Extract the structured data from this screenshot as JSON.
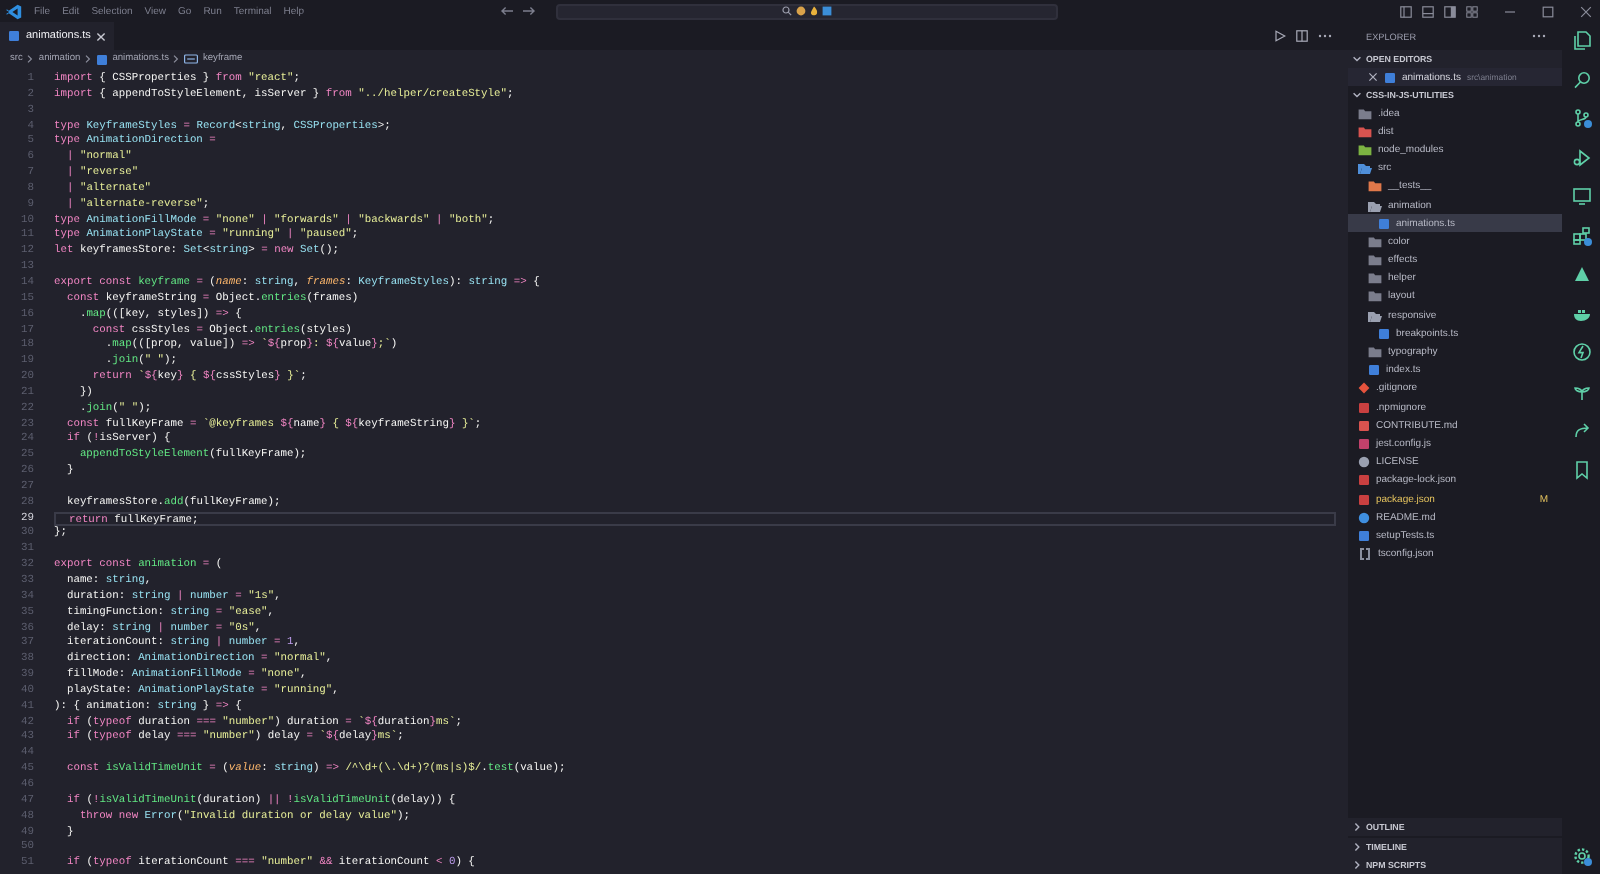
{
  "title_bar": {
    "menu": [
      "File",
      "Edit",
      "Selection",
      "View",
      "Go",
      "Run",
      "Terminal",
      "Help"
    ]
  },
  "tabs": [
    {
      "label": "animations.ts",
      "selected": true
    }
  ],
  "breadcrumb": [
    {
      "label": "src",
      "kind": "folder"
    },
    {
      "label": "animation",
      "kind": "folder"
    },
    {
      "label": "animations.ts",
      "kind": "ts"
    },
    {
      "label": "keyframe",
      "kind": "symbol"
    }
  ],
  "editor": {
    "lines": [
      {
        "number": "1",
        "current": false,
        "tokens": [
          {
            "kind": "kw",
            "text": "import"
          },
          {
            "kind": "text",
            "text": " { CSSProperties } "
          },
          {
            "kind": "kw",
            "text": "from"
          },
          {
            "kind": "str",
            "text": " \"react\""
          },
          {
            "kind": "text",
            "text": ";"
          }
        ]
      },
      {
        "number": "2",
        "current": false,
        "tokens": [
          {
            "kind": "kw",
            "text": "import"
          },
          {
            "kind": "text",
            "text": " { appendToStyleElement, isServer } "
          },
          {
            "kind": "kw",
            "text": "from"
          },
          {
            "kind": "str",
            "text": " \"../helper/createStyle\""
          },
          {
            "kind": "text",
            "text": ";"
          }
        ]
      },
      {
        "number": "3",
        "current": false
      },
      {
        "number": "4",
        "current": false,
        "tokens": [
          {
            "kind": "kw",
            "text": "type"
          },
          {
            "kind": "type",
            "text": " KeyframeStyles"
          },
          {
            "kind": "op",
            "text": " = "
          },
          {
            "kind": "type",
            "text": "Record"
          },
          {
            "kind": "text",
            "text": "<"
          },
          {
            "kind": "type",
            "text": "string"
          },
          {
            "kind": "text",
            "text": ", "
          },
          {
            "kind": "type",
            "text": "CSSProperties"
          },
          {
            "kind": "text",
            "text": ">;"
          }
        ]
      },
      {
        "number": "5",
        "current": false,
        "tokens": [
          {
            "kind": "kw",
            "text": "type"
          },
          {
            "kind": "type",
            "text": " AnimationDirection"
          },
          {
            "kind": "op",
            "text": " ="
          }
        ]
      },
      {
        "number": "6",
        "current": false,
        "tokens": [
          {
            "kind": "op",
            "text": "  | "
          },
          {
            "kind": "str",
            "text": "\"normal\""
          }
        ]
      },
      {
        "number": "7",
        "current": false,
        "tokens": [
          {
            "kind": "op",
            "text": "  | "
          },
          {
            "kind": "str",
            "text": "\"reverse\""
          }
        ]
      },
      {
        "number": "8",
        "current": false,
        "tokens": [
          {
            "kind": "op",
            "text": "  | "
          },
          {
            "kind": "str",
            "text": "\"alternate\""
          }
        ]
      },
      {
        "number": "9",
        "current": false,
        "tokens": [
          {
            "kind": "op",
            "text": "  | "
          },
          {
            "kind": "str",
            "text": "\"alternate-reverse\""
          },
          {
            "kind": "text",
            "text": ";"
          }
        ]
      },
      {
        "number": "10",
        "current": false,
        "tokens": [
          {
            "kind": "kw",
            "text": "type"
          },
          {
            "kind": "type",
            "text": " AnimationFillMode"
          },
          {
            "kind": "op",
            "text": " = "
          },
          {
            "kind": "str",
            "text": "\"none\""
          },
          {
            "kind": "op",
            "text": " | "
          },
          {
            "kind": "str",
            "text": "\"forwards\""
          },
          {
            "kind": "op",
            "text": " | "
          },
          {
            "kind": "str",
            "text": "\"backwards\""
          },
          {
            "kind": "op",
            "text": " | "
          },
          {
            "kind": "str",
            "text": "\"both\""
          },
          {
            "kind": "text",
            "text": ";"
          }
        ]
      },
      {
        "number": "11",
        "current": false,
        "tokens": [
          {
            "kind": "kw",
            "text": "type"
          },
          {
            "kind": "type",
            "text": " AnimationPlayState"
          },
          {
            "kind": "op",
            "text": " = "
          },
          {
            "kind": "str",
            "text": "\"running\""
          },
          {
            "kind": "op",
            "text": " | "
          },
          {
            "kind": "str",
            "text": "\"paused\""
          },
          {
            "kind": "text",
            "text": ";"
          }
        ]
      },
      {
        "number": "12",
        "current": false,
        "tokens": [
          {
            "kind": "kw",
            "text": "let"
          },
          {
            "kind": "text",
            "text": " keyframesStore: "
          },
          {
            "kind": "type",
            "text": "Set"
          },
          {
            "kind": "text",
            "text": "<"
          },
          {
            "kind": "type",
            "text": "string"
          },
          {
            "kind": "text",
            "text": "> "
          },
          {
            "kind": "op",
            "text": "="
          },
          {
            "kind": "kw",
            "text": " new"
          },
          {
            "kind": "type",
            "text": " Set"
          },
          {
            "kind": "text",
            "text": "();"
          }
        ]
      },
      {
        "number": "13",
        "current": false
      },
      {
        "number": "14",
        "current": false,
        "tokens": [
          {
            "kind": "kw",
            "text": "export const"
          },
          {
            "kind": "fn",
            "text": " keyframe"
          },
          {
            "kind": "op",
            "text": " = "
          },
          {
            "kind": "text",
            "text": "("
          },
          {
            "kind": "param",
            "text": "name"
          },
          {
            "kind": "text",
            "text": ": "
          },
          {
            "kind": "type",
            "text": "string"
          },
          {
            "kind": "text",
            "text": ", "
          },
          {
            "kind": "param",
            "text": "frames"
          },
          {
            "kind": "text",
            "text": ": "
          },
          {
            "kind": "type",
            "text": "KeyframeStyles"
          },
          {
            "kind": "text",
            "text": "): "
          },
          {
            "kind": "type",
            "text": "string"
          },
          {
            "kind": "op",
            "text": " =>"
          },
          {
            "kind": "text",
            "text": " {"
          }
        ]
      },
      {
        "number": "15",
        "current": false,
        "tokens": [
          {
            "kind": "kw",
            "text": "  const"
          },
          {
            "kind": "text",
            "text": " keyframeString "
          },
          {
            "kind": "op",
            "text": "="
          },
          {
            "kind": "text",
            "text": " Object."
          },
          {
            "kind": "fn",
            "text": "entries"
          },
          {
            "kind": "text",
            "text": "(frames)"
          }
        ]
      },
      {
        "number": "16",
        "current": false,
        "tokens": [
          {
            "kind": "text",
            "text": "    ."
          },
          {
            "kind": "fn",
            "text": "map"
          },
          {
            "kind": "text",
            "text": "(([key, styles]) "
          },
          {
            "kind": "op",
            "text": "=>"
          },
          {
            "kind": "text",
            "text": " {"
          }
        ]
      },
      {
        "number": "17",
        "current": false,
        "tokens": [
          {
            "kind": "kw",
            "text": "      const"
          },
          {
            "kind": "text",
            "text": " cssStyles "
          },
          {
            "kind": "op",
            "text": "="
          },
          {
            "kind": "text",
            "text": " Object."
          },
          {
            "kind": "fn",
            "text": "entries"
          },
          {
            "kind": "text",
            "text": "(styles)"
          }
        ]
      },
      {
        "number": "18",
        "current": false,
        "tokens": [
          {
            "kind": "text",
            "text": "        ."
          },
          {
            "kind": "fn",
            "text": "map"
          },
          {
            "kind": "text",
            "text": "(([prop, value]) "
          },
          {
            "kind": "op",
            "text": "=>"
          },
          {
            "kind": "str",
            "text": " `"
          },
          {
            "kind": "kw",
            "text": "${"
          },
          {
            "kind": "text",
            "text": "prop"
          },
          {
            "kind": "kw",
            "text": "}"
          },
          {
            "kind": "str",
            "text": ": "
          },
          {
            "kind": "kw",
            "text": "${"
          },
          {
            "kind": "text",
            "text": "value"
          },
          {
            "kind": "kw",
            "text": "}"
          },
          {
            "kind": "str",
            "text": ";`"
          },
          {
            "kind": "text",
            "text": ")"
          }
        ]
      },
      {
        "number": "19",
        "current": false,
        "tokens": [
          {
            "kind": "text",
            "text": "        ."
          },
          {
            "kind": "fn",
            "text": "join"
          },
          {
            "kind": "text",
            "text": "("
          },
          {
            "kind": "str",
            "text": "\" \""
          },
          {
            "kind": "text",
            "text": ");"
          }
        ]
      },
      {
        "number": "20",
        "current": false,
        "tokens": [
          {
            "kind": "kw",
            "text": "      return"
          },
          {
            "kind": "str",
            "text": " `"
          },
          {
            "kind": "kw",
            "text": "${"
          },
          {
            "kind": "text",
            "text": "key"
          },
          {
            "kind": "kw",
            "text": "}"
          },
          {
            "kind": "str",
            "text": " { "
          },
          {
            "kind": "kw",
            "text": "${"
          },
          {
            "kind": "text",
            "text": "cssStyles"
          },
          {
            "kind": "kw",
            "text": "}"
          },
          {
            "kind": "str",
            "text": " }`"
          },
          {
            "kind": "text",
            "text": ";"
          }
        ]
      },
      {
        "number": "21",
        "current": false,
        "tokens": [
          {
            "kind": "text",
            "text": "    })"
          }
        ]
      },
      {
        "number": "22",
        "current": false,
        "tokens": [
          {
            "kind": "text",
            "text": "    ."
          },
          {
            "kind": "fn",
            "text": "join"
          },
          {
            "kind": "text",
            "text": "("
          },
          {
            "kind": "str",
            "text": "\" \""
          },
          {
            "kind": "text",
            "text": ");"
          }
        ]
      },
      {
        "number": "23",
        "current": false,
        "tokens": [
          {
            "kind": "kw",
            "text": "  const"
          },
          {
            "kind": "text",
            "text": " fullKeyFrame "
          },
          {
            "kind": "op",
            "text": "="
          },
          {
            "kind": "str",
            "text": " `@keyframes "
          },
          {
            "kind": "kw",
            "text": "${"
          },
          {
            "kind": "text",
            "text": "name"
          },
          {
            "kind": "kw",
            "text": "}"
          },
          {
            "kind": "str",
            "text": " { "
          },
          {
            "kind": "kw",
            "text": "${"
          },
          {
            "kind": "text",
            "text": "keyframeString"
          },
          {
            "kind": "kw",
            "text": "}"
          },
          {
            "kind": "str",
            "text": " }`"
          },
          {
            "kind": "text",
            "text": ";"
          }
        ]
      },
      {
        "number": "24",
        "current": false,
        "tokens": [
          {
            "kind": "kw",
            "text": "  if"
          },
          {
            "kind": "text",
            "text": " ("
          },
          {
            "kind": "op",
            "text": "!"
          },
          {
            "kind": "text",
            "text": "isServer) {"
          }
        ]
      },
      {
        "number": "25",
        "current": false,
        "tokens": [
          {
            "kind": "fn",
            "text": "    appendToStyleElement"
          },
          {
            "kind": "text",
            "text": "(fullKeyFrame);"
          }
        ]
      },
      {
        "number": "26",
        "current": false,
        "tokens": [
          {
            "kind": "text",
            "text": "  }"
          }
        ]
      },
      {
        "number": "27",
        "current": false
      },
      {
        "number": "28",
        "current": false,
        "tokens": [
          {
            "kind": "text",
            "text": "  keyframesStore."
          },
          {
            "kind": "fn",
            "text": "add"
          },
          {
            "kind": "text",
            "text": "(fullKeyFrame);"
          }
        ]
      },
      {
        "number": "29",
        "current": true,
        "tokens": [
          {
            "kind": "kw",
            "text": "  return"
          },
          {
            "kind": "text",
            "text": " fullKeyFrame;"
          }
        ]
      },
      {
        "number": "30",
        "current": false,
        "tokens": [
          {
            "kind": "text",
            "text": "};"
          }
        ]
      },
      {
        "number": "31",
        "current": false
      },
      {
        "number": "32",
        "current": false,
        "tokens": [
          {
            "kind": "kw",
            "text": "export const"
          },
          {
            "kind": "fn",
            "text": " animation"
          },
          {
            "kind": "op",
            "text": " = "
          },
          {
            "kind": "text",
            "text": "("
          }
        ]
      },
      {
        "number": "33",
        "current": false,
        "tokens": [
          {
            "kind": "text",
            "text": "  name: "
          },
          {
            "kind": "type",
            "text": "string"
          },
          {
            "kind": "text",
            "text": ","
          }
        ]
      },
      {
        "number": "34",
        "current": false,
        "tokens": [
          {
            "kind": "text",
            "text": "  duration: "
          },
          {
            "kind": "type",
            "text": "string"
          },
          {
            "kind": "op",
            "text": " | "
          },
          {
            "kind": "type",
            "text": "number"
          },
          {
            "kind": "op",
            "text": " = "
          },
          {
            "kind": "str",
            "text": "\"1s\""
          },
          {
            "kind": "text",
            "text": ","
          }
        ]
      },
      {
        "number": "35",
        "current": false,
        "tokens": [
          {
            "kind": "text",
            "text": "  timingFunction: "
          },
          {
            "kind": "type",
            "text": "string"
          },
          {
            "kind": "op",
            "text": " = "
          },
          {
            "kind": "str",
            "text": "\"ease\""
          },
          {
            "kind": "text",
            "text": ","
          }
        ]
      },
      {
        "number": "36",
        "current": false,
        "tokens": [
          {
            "kind": "text",
            "text": "  delay: "
          },
          {
            "kind": "type",
            "text": "string"
          },
          {
            "kind": "op",
            "text": " | "
          },
          {
            "kind": "type",
            "text": "number"
          },
          {
            "kind": "op",
            "text": " = "
          },
          {
            "kind": "str",
            "text": "\"0s\""
          },
          {
            "kind": "text",
            "text": ","
          }
        ]
      },
      {
        "number": "37",
        "current": false,
        "tokens": [
          {
            "kind": "text",
            "text": "  iterationCount: "
          },
          {
            "kind": "type",
            "text": "string"
          },
          {
            "kind": "op",
            "text": " | "
          },
          {
            "kind": "type",
            "text": "number"
          },
          {
            "kind": "op",
            "text": " = "
          },
          {
            "kind": "num",
            "text": "1"
          },
          {
            "kind": "text",
            "text": ","
          }
        ]
      },
      {
        "number": "38",
        "current": false,
        "tokens": [
          {
            "kind": "text",
            "text": "  direction: "
          },
          {
            "kind": "type",
            "text": "AnimationDirection"
          },
          {
            "kind": "op",
            "text": " = "
          },
          {
            "kind": "str",
            "text": "\"normal\""
          },
          {
            "kind": "text",
            "text": ","
          }
        ]
      },
      {
        "number": "39",
        "current": false,
        "tokens": [
          {
            "kind": "text",
            "text": "  fillMode: "
          },
          {
            "kind": "type",
            "text": "AnimationFillMode"
          },
          {
            "kind": "op",
            "text": " = "
          },
          {
            "kind": "str",
            "text": "\"none\""
          },
          {
            "kind": "text",
            "text": ","
          }
        ]
      },
      {
        "number": "40",
        "current": false,
        "tokens": [
          {
            "kind": "text",
            "text": "  playState: "
          },
          {
            "kind": "type",
            "text": "AnimationPlayState"
          },
          {
            "kind": "op",
            "text": " = "
          },
          {
            "kind": "str",
            "text": "\"running\""
          },
          {
            "kind": "text",
            "text": ","
          }
        ]
      },
      {
        "number": "41",
        "current": false,
        "tokens": [
          {
            "kind": "text",
            "text": "): { animation: "
          },
          {
            "kind": "type",
            "text": "string"
          },
          {
            "kind": "text",
            "text": " } "
          },
          {
            "kind": "op",
            "text": "=>"
          },
          {
            "kind": "text",
            "text": " {"
          }
        ]
      },
      {
        "number": "42",
        "current": false,
        "tokens": [
          {
            "kind": "kw",
            "text": "  if"
          },
          {
            "kind": "text",
            "text": " ("
          },
          {
            "kind": "kw",
            "text": "typeof"
          },
          {
            "kind": "text",
            "text": " duration "
          },
          {
            "kind": "op",
            "text": "==="
          },
          {
            "kind": "str",
            "text": " \"number\""
          },
          {
            "kind": "text",
            "text": ") duration "
          },
          {
            "kind": "op",
            "text": "="
          },
          {
            "kind": "str",
            "text": " `"
          },
          {
            "kind": "kw",
            "text": "${"
          },
          {
            "kind": "text",
            "text": "duration"
          },
          {
            "kind": "kw",
            "text": "}"
          },
          {
            "kind": "str",
            "text": "ms`"
          },
          {
            "kind": "text",
            "text": ";"
          }
        ]
      },
      {
        "number": "43",
        "current": false,
        "tokens": [
          {
            "kind": "kw",
            "text": "  if"
          },
          {
            "kind": "text",
            "text": " ("
          },
          {
            "kind": "kw",
            "text": "typeof"
          },
          {
            "kind": "text",
            "text": " delay "
          },
          {
            "kind": "op",
            "text": "==="
          },
          {
            "kind": "str",
            "text": " \"number\""
          },
          {
            "kind": "text",
            "text": ") delay "
          },
          {
            "kind": "op",
            "text": "="
          },
          {
            "kind": "str",
            "text": " `"
          },
          {
            "kind": "kw",
            "text": "${"
          },
          {
            "kind": "text",
            "text": "delay"
          },
          {
            "kind": "kw",
            "text": "}"
          },
          {
            "kind": "str",
            "text": "ms`"
          },
          {
            "kind": "text",
            "text": ";"
          }
        ]
      },
      {
        "number": "44",
        "current": false
      },
      {
        "number": "45",
        "current": false,
        "tokens": [
          {
            "kind": "kw",
            "text": "  const"
          },
          {
            "kind": "fn",
            "text": " isValidTimeUnit"
          },
          {
            "kind": "op",
            "text": " = "
          },
          {
            "kind": "text",
            "text": "("
          },
          {
            "kind": "param",
            "text": "value"
          },
          {
            "kind": "text",
            "text": ": "
          },
          {
            "kind": "type",
            "text": "string"
          },
          {
            "kind": "text",
            "text": ") "
          },
          {
            "kind": "op",
            "text": "=>"
          },
          {
            "kind": "str",
            "text": " /^\\d+(\\.\\d+)?(ms|s)$/"
          },
          {
            "kind": "text",
            "text": "."
          },
          {
            "kind": "fn",
            "text": "test"
          },
          {
            "kind": "text",
            "text": "(value);"
          }
        ]
      },
      {
        "number": "46",
        "current": false
      },
      {
        "number": "47",
        "current": false,
        "tokens": [
          {
            "kind": "kw",
            "text": "  if"
          },
          {
            "kind": "text",
            "text": " ("
          },
          {
            "kind": "op",
            "text": "!"
          },
          {
            "kind": "fn",
            "text": "isValidTimeUnit"
          },
          {
            "kind": "text",
            "text": "(duration) "
          },
          {
            "kind": "op",
            "text": "|| !"
          },
          {
            "kind": "fn",
            "text": "isValidTimeUnit"
          },
          {
            "kind": "text",
            "text": "(delay)) {"
          }
        ]
      },
      {
        "number": "48",
        "current": false,
        "tokens": [
          {
            "kind": "kw",
            "text": "    throw new"
          },
          {
            "kind": "type",
            "text": " Error"
          },
          {
            "kind": "text",
            "text": "("
          },
          {
            "kind": "str",
            "text": "\"Invalid duration or delay value\""
          },
          {
            "kind": "text",
            "text": ");"
          }
        ]
      },
      {
        "number": "49",
        "current": false,
        "tokens": [
          {
            "kind": "text",
            "text": "  }"
          }
        ]
      },
      {
        "number": "50",
        "current": false
      },
      {
        "number": "51",
        "current": false,
        "tokens": [
          {
            "kind": "kw",
            "text": "  if"
          },
          {
            "kind": "text",
            "text": " ("
          },
          {
            "kind": "kw",
            "text": "typeof"
          },
          {
            "kind": "text",
            "text": " iterationCount "
          },
          {
            "kind": "op",
            "text": "==="
          },
          {
            "kind": "str",
            "text": " \"number\""
          },
          {
            "kind": "op",
            "text": " &&"
          },
          {
            "kind": "text",
            "text": " iterationCount "
          },
          {
            "kind": "op",
            "text": "<"
          },
          {
            "kind": "num",
            "text": " 0"
          },
          {
            "kind": "text",
            "text": ") {"
          }
        ]
      }
    ]
  },
  "explorer": {
    "title": "EXPLORER",
    "open_editors": {
      "label": "OPEN EDITORS",
      "expanded": true,
      "items": [
        {
          "name": "animations.ts",
          "path": "src\\animation",
          "kind": "file",
          "color": "#3f7fd9"
        }
      ]
    },
    "folder": {
      "label": "CSS-IN-JS-UTILITIES",
      "expanded": true,
      "children": [
        {
          "name": ".idea",
          "kind": "folder",
          "color": "#7b7d8c",
          "expanded": false,
          "selected": false
        },
        {
          "name": "dist",
          "kind": "folder",
          "color": "#d9534f",
          "expanded": false,
          "selected": false
        },
        {
          "name": "node_modules",
          "kind": "folder",
          "color": "#7cb342",
          "expanded": false,
          "selected": false
        },
        {
          "name": "src",
          "kind": "folder",
          "color": "#4f8fd9",
          "expanded": true,
          "selected": false,
          "children": [
            {
              "name": "__tests__",
              "kind": "folder",
              "color": "#e0784a",
              "expanded": false,
              "selected": false
            },
            {
              "name": "animation",
              "kind": "folder",
              "color": "#9aa0b0",
              "expanded": true,
              "selected": false,
              "children": [
                {
                  "name": "animations.ts",
                  "kind": "file",
                  "color": "#3f7fd9",
                  "selected": true
                }
              ]
            },
            {
              "name": "color",
              "kind": "folder",
              "color": "#7b7d8c",
              "expanded": false,
              "selected": false
            },
            {
              "name": "effects",
              "kind": "folder",
              "color": "#7b7d8c",
              "expanded": false,
              "selected": false
            },
            {
              "name": "helper",
              "kind": "folder",
              "color": "#7b7d8c",
              "expanded": false,
              "selected": false
            },
            {
              "name": "layout",
              "kind": "folder",
              "color": "#7b7d8c",
              "expanded": false,
              "selected": false
            },
            {
              "name": "responsive",
              "kind": "folder",
              "color": "#9aa0b0",
              "expanded": true,
              "selected": false,
              "children": [
                {
                  "name": "breakpoints.ts",
                  "kind": "file",
                  "color": "#3f7fd9",
                  "selected": false
                }
              ]
            },
            {
              "name": "typography",
              "kind": "folder",
              "color": "#7b7d8c",
              "expanded": false,
              "selected": false
            },
            {
              "name": "index.ts",
              "kind": "file",
              "color": "#3f7fd9",
              "selected": false
            }
          ]
        },
        {
          "name": ".gitignore",
          "kind": "diamond",
          "color": "#e5533d",
          "selected": false
        },
        {
          "name": ".npmignore",
          "kind": "file",
          "color": "#c94040",
          "selected": false
        },
        {
          "name": "CONTRIBUTE.md",
          "kind": "file",
          "color": "#d9534f",
          "selected": false
        },
        {
          "name": "jest.config.js",
          "kind": "file",
          "color": "#c2416b",
          "selected": false
        },
        {
          "name": "LICENSE",
          "kind": "circle",
          "color": "#9aa0b0",
          "selected": false
        },
        {
          "name": "package-lock.json",
          "kind": "file",
          "color": "#c94040",
          "selected": false
        },
        {
          "name": "package.json",
          "kind": "file",
          "color": "#c94040",
          "selected": false,
          "status": "M"
        },
        {
          "name": "README.md",
          "kind": "circle",
          "color": "#3f8fe0",
          "selected": false
        },
        {
          "name": "setupTests.ts",
          "kind": "file",
          "color": "#3f7fd9",
          "selected": false
        },
        {
          "name": "tsconfig.json",
          "kind": "braces",
          "color": "#8a8f9f",
          "selected": false
        }
      ]
    },
    "panels": [
      {
        "label": "OUTLINE",
        "expanded": false
      },
      {
        "label": "TIMELINE",
        "expanded": false
      },
      {
        "label": "NPM SCRIPTS",
        "expanded": false
      }
    ]
  }
}
